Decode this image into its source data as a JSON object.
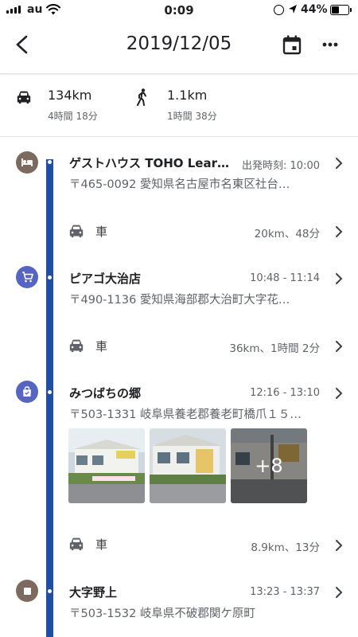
{
  "status_bar": {
    "carrier": "au",
    "time": "0:09",
    "battery": "44%",
    "battery_level": 0.44
  },
  "header": {
    "title": "2019/12/05",
    "back_icon": "chevron-left-icon",
    "calendar_icon": "calendar-icon",
    "more_icon": "more-horizontal-icon"
  },
  "summary": {
    "drive": {
      "icon": "car-icon",
      "distance": "134km",
      "duration": "4時間 18分"
    },
    "walk": {
      "icon": "walk-icon",
      "distance": "1.1km",
      "duration": "1時間 38分"
    }
  },
  "timeline": {
    "accent_color": "#1f4ea3",
    "places": [
      {
        "name": "ゲストハウス TOHO Lear…",
        "time": "出発時刻: 10:00",
        "address": "〒465-0092 愛知県名古屋市名東区社台…",
        "icon": "bed-icon",
        "color": "#7d6a5e"
      },
      {
        "name": "ピアゴ大治店",
        "time": "10:48 - 11:14",
        "address": "〒490-1136 愛知県海部郡大治町大字花…",
        "icon": "shopping-cart-icon",
        "color": "#5765c2"
      },
      {
        "name": "みつばちの郷",
        "time": "12:16 - 13:10",
        "address": "〒503-1331 岐阜県養老郡養老町橋爪１５…",
        "icon": "shopping-bag-icon",
        "color": "#5765c2",
        "photos_more": "+8"
      },
      {
        "name": "大字野上",
        "time": "13:23 - 13:37",
        "address": "〒503-1532 岐阜県不破郡関ケ原町",
        "icon": "stop-icon",
        "color": "#7d6a5e"
      }
    ],
    "segments": [
      {
        "mode": "車",
        "icon": "car-icon",
        "detail": "20km、48分"
      },
      {
        "mode": "車",
        "icon": "car-icon",
        "detail": "36km、1時間 2分"
      },
      {
        "mode": "車",
        "icon": "car-icon",
        "detail": "8.9km、13分"
      }
    ]
  }
}
